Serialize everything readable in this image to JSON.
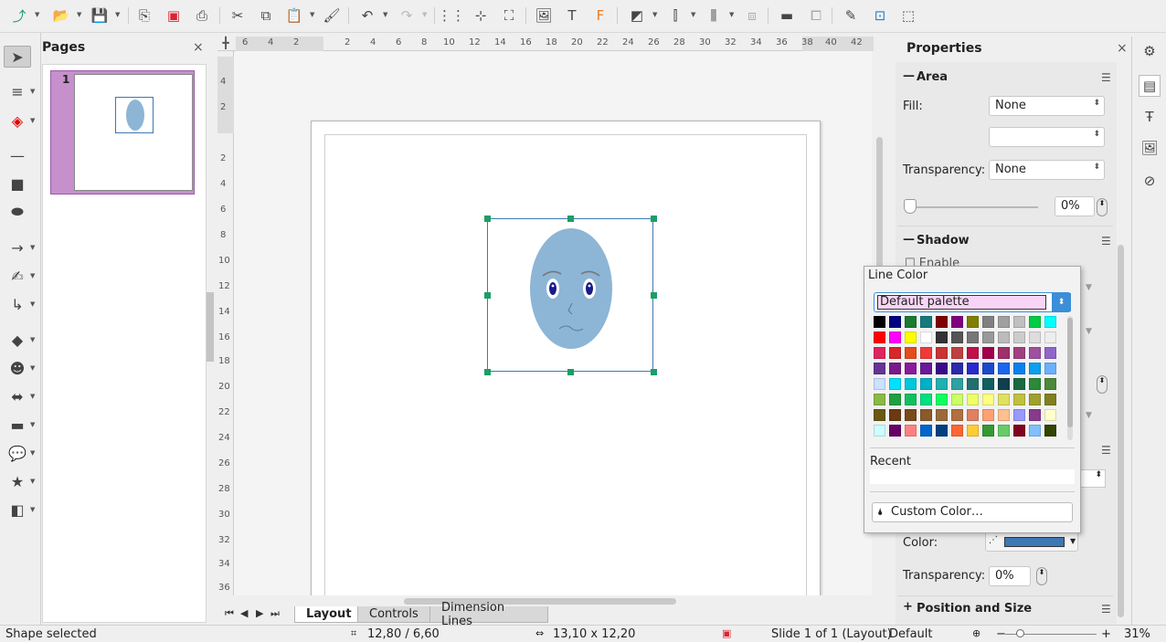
{
  "toolbar": {
    "icons": [
      "connector-icon",
      "open-icon",
      "save-icon",
      "new-page-icon",
      "export-pdf-icon",
      "print-icon",
      "cut-icon",
      "copy-icon",
      "paste-icon",
      "clone-format-icon",
      "undo-icon",
      "redo-icon",
      "grid-icon",
      "snap-guides-icon",
      "crop-icon",
      "insert-image-icon",
      "insert-textbox-icon",
      "fontwork-icon",
      "transformations-icon",
      "align-icon",
      "arrange-icon",
      "distribute-icon",
      "shadow-icon",
      "crop-image-icon",
      "edit-points-icon",
      "gluepoints-icon",
      "3d-object-icon"
    ]
  },
  "pages_panel": {
    "title": "Pages",
    "close": "×",
    "page_number": "1"
  },
  "ruler": {
    "top": [
      "6",
      "4",
      "2",
      "2",
      "4",
      "6",
      "8",
      "10",
      "12",
      "14",
      "16",
      "18",
      "20",
      "22",
      "24",
      "26",
      "28",
      "30",
      "32",
      "34",
      "36",
      "38",
      "40",
      "42"
    ],
    "left": [
      "4",
      "2",
      "2",
      "4",
      "6",
      "8",
      "10",
      "12",
      "14",
      "16",
      "18",
      "20",
      "22",
      "24",
      "26",
      "28",
      "30",
      "32",
      "34",
      "36"
    ]
  },
  "tabs": {
    "layout": "Layout",
    "controls": "Controls",
    "dimension": "Dimension Lines"
  },
  "properties": {
    "title": "Properties",
    "close": "×",
    "area": {
      "title": "Area",
      "fill_label": "Fill:",
      "fill_value": "None",
      "transparency_label": "Transparency:",
      "transparency_value": "None",
      "transparency_percent": "0%"
    },
    "shadow": {
      "title": "Shadow",
      "enable_label": "Enable"
    },
    "line": {
      "color_label": "Color:",
      "color": "#3d78b4",
      "transparency_label": "Transparency:",
      "transparency_value": "0%"
    },
    "position_size": {
      "title": "Position and Size"
    }
  },
  "line_color_popup": {
    "title": "Line Color",
    "palette": "Default palette",
    "recent_label": "Recent",
    "custom_color": "Custom Color…",
    "swatches": [
      [
        "#000000",
        "#000080",
        "#1a7a2e",
        "#147a7a",
        "#800000",
        "#800080",
        "#808000",
        "#808080",
        "#a0a0a0",
        "#c0c0c0",
        "#00cc44",
        "#00ffff"
      ],
      [
        "#ff0000",
        "#ff00ff",
        "#ffff00",
        "#ffffff",
        "#333333",
        "#555555",
        "#777777",
        "#999999",
        "#bbbbbb",
        "#cccccc",
        "#dddddd",
        "#eeeeee"
      ],
      [
        "#e0245e",
        "#d62828",
        "#e34d1c",
        "#f03a3a",
        "#cc3333",
        "#c04040",
        "#c0104a",
        "#a0004a",
        "#a0306a",
        "#a04080",
        "#a050a0",
        "#9066cc"
      ],
      [
        "#663399",
        "#7a1a8a",
        "#8a1a9a",
        "#6a1a9a",
        "#3a0a8a",
        "#2a2aaa",
        "#2a2acc",
        "#1a4acc",
        "#1a66ee",
        "#0a80ee",
        "#0aa0ee",
        "#6ab0ff"
      ],
      [
        "#cce0ff",
        "#00e0ff",
        "#00c8dd",
        "#00b0c8",
        "#20b0b0",
        "#30a0a0",
        "#207070",
        "#106060",
        "#104050",
        "#1a6a40",
        "#2a8a3a",
        "#4a8a3a"
      ],
      [
        "#88bb44",
        "#20a040",
        "#10c060",
        "#00e080",
        "#10ff60",
        "#ccff66",
        "#eeff66",
        "#ffff80",
        "#e0e060",
        "#c0c040",
        "#a0a030",
        "#808020"
      ],
      [
        "#6a5a10",
        "#6a3a10",
        "#7a4a1a",
        "#8a5a2a",
        "#9a6a3a",
        "#b07040",
        "#e08060",
        "#ffa070",
        "#ffc090",
        "#9999ff",
        "#8a3a8a",
        "#ffffcc"
      ],
      [
        "#ccffff",
        "#660066",
        "#ff8080",
        "#0066cc",
        "#004080",
        "#ff6633",
        "#ffcc33",
        "#339933",
        "#66cc66",
        "#800020",
        "#80c0ff",
        "#334400"
      ]
    ]
  },
  "status": {
    "selection": "Shape selected",
    "position": "12,80 / 6,60",
    "size": "13,10 x 12,20",
    "slide": "Slide 1 of 1 (Layout)",
    "layout": "Default",
    "zoom": "31%"
  }
}
